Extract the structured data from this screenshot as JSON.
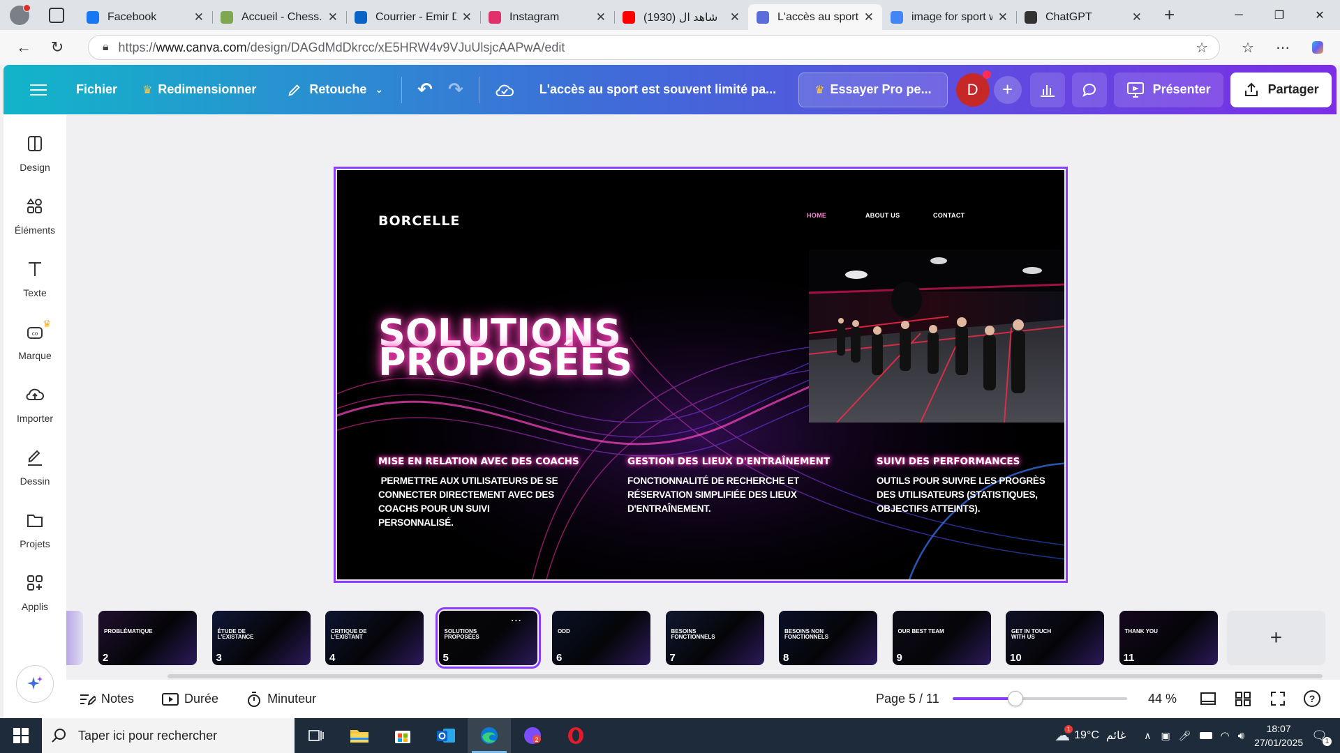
{
  "browser": {
    "tabs": [
      {
        "title": "Facebook",
        "icon": "facebook-icon",
        "color": "#1877f2",
        "active": false
      },
      {
        "title": "Accueil - Chess.com",
        "icon": "chess-pawn-icon",
        "color": "#7fa650",
        "active": false
      },
      {
        "title": "Courrier - Emir D...",
        "icon": "outlook-icon",
        "color": "#0a64c8",
        "active": false
      },
      {
        "title": "Instagram",
        "icon": "instagram-icon",
        "color": "#e1306c",
        "active": false
      },
      {
        "title": "(1930) شاهد ال",
        "icon": "youtube-icon",
        "color": "#ff0000",
        "active": false
      },
      {
        "title": "L'accès au sport e...",
        "icon": "canva-icon",
        "color": "#5b6dd8",
        "active": true
      },
      {
        "title": "image for sport w...",
        "icon": "google-icon",
        "color": "#4285f4",
        "active": false
      },
      {
        "title": "ChatGPT",
        "icon": "chatgpt-icon",
        "color": "#333333",
        "active": false
      }
    ],
    "url_prefix": "https://",
    "url_domain": "www.canva.com",
    "url_path": "/design/DAGdMdDkrcc/xE5HRW4v9VJuUlsjcAAPwA/edit"
  },
  "canva": {
    "toolbar": {
      "file": "Fichier",
      "resize": "Redimensionner",
      "edit": "Retouche",
      "doc_title": "L'accès au sport est souvent limité pa...",
      "try_pro": "Essayer Pro pe...",
      "avatar_letter": "D",
      "present": "Présenter",
      "share": "Partager"
    },
    "sidebar": [
      {
        "label": "Design",
        "icon": "design-icon"
      },
      {
        "label": "Éléments",
        "icon": "elements-icon"
      },
      {
        "label": "Texte",
        "icon": "text-icon"
      },
      {
        "label": "Marque",
        "icon": "brand-icon"
      },
      {
        "label": "Importer",
        "icon": "upload-cloud-icon"
      },
      {
        "label": "Dessin",
        "icon": "draw-icon"
      },
      {
        "label": "Projets",
        "icon": "folder-icon"
      },
      {
        "label": "Applis",
        "icon": "apps-icon"
      }
    ],
    "slide": {
      "brand": "BORCELLE",
      "nav": [
        "HOME",
        "ABOUT US",
        "CONTACT"
      ],
      "hero_line1": "SOLUTIONS",
      "hero_line2": "PROPOSÉES",
      "columns": [
        {
          "title": "MISE EN RELATION AVEC DES COACHS",
          "body": " PERMETTRE AUX UTILISATEURS DE SE CONNECTER DIRECTEMENT AVEC DES COACHS POUR UN SUIVI PERSONNALISÉ."
        },
        {
          "title": "GESTION DES LIEUX D'ENTRAÎNEMENT",
          "body": "FONCTIONNALITÉ DE RECHERCHE ET RÉSERVATION SIMPLIFIÉE DES LIEUX D'ENTRAÎNEMENT."
        },
        {
          "title": "SUIVI DES PERFORMANCES",
          "body": "OUTILS POUR SUIVRE LES PROGRÈS DES UTILISATEURS (STATISTIQUES, OBJECTIFS ATTEINTS)."
        }
      ]
    },
    "thumbnails": [
      {
        "num": "2",
        "label": "PROBLÉMATIQUE"
      },
      {
        "num": "3",
        "label": "ÉTUDE DE L'EXISTANCE"
      },
      {
        "num": "4",
        "label": "CRITIQUE DE L'EXISTANT"
      },
      {
        "num": "5",
        "label": "SOLUTIONS PROPOSÉES",
        "selected": true
      },
      {
        "num": "6",
        "label": "ODD"
      },
      {
        "num": "7",
        "label": "BESOINS FONCTIONNELS"
      },
      {
        "num": "8",
        "label": "BESOINS NON FONCTIONNELS"
      },
      {
        "num": "9",
        "label": "OUR BEST TEAM"
      },
      {
        "num": "10",
        "label": "GET IN TOUCH WITH US"
      },
      {
        "num": "11",
        "label": "THANK YOU"
      }
    ],
    "bottom": {
      "notes": "Notes",
      "duration": "Durée",
      "timer": "Minuteur",
      "page": "Page 5 / 11",
      "zoom": "44 %",
      "zoom_fraction": 0.36
    }
  },
  "taskbar": {
    "search_placeholder": "Taper ici pour rechercher",
    "weather": "19°C",
    "weather_desc": "غائم",
    "time": "18:07",
    "date": "27/01/2025",
    "notif_count": "1"
  }
}
